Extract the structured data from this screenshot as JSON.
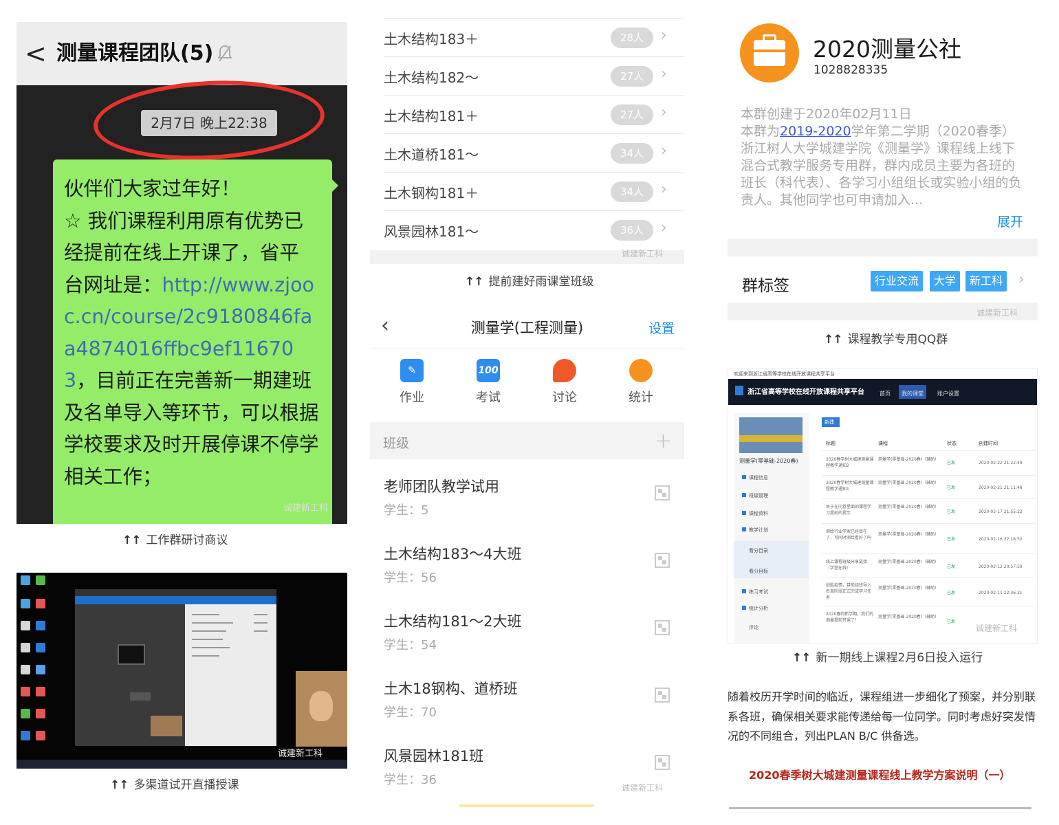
{
  "chat": {
    "back_icon": "back-arrow-icon",
    "title": "测量课程团队(5)",
    "mute_icon": "muted-bell-icon",
    "timestamp": "2月7日 晚上22:38",
    "message_lines": [
      "伙伴们大家过年好！",
      "☆ 我们课程利用原有优势已",
      "经提前在线上开课了，省平",
      "台网址是："
    ],
    "message_link": "http://www.zjooc.cn/course/2c9180846faa4874016ffbc9ef116703",
    "message_rest": "，目前正在完善新一期建班及名单导入等环节，可以根据学校要求及时开展停课不停学相关工作；",
    "watermark": "诚建新工科",
    "highlight_color": "#e8322b",
    "bubble_color": "#95ec69"
  },
  "captions": {
    "arrows": "↑↑",
    "chat": "工作群研讨商议",
    "desktop": "多渠道试开直播授课",
    "class_list": "提前建好雨课堂班级",
    "qq": "课程教学专用QQ群",
    "web": "新一期线上课程2月6日投入运行"
  },
  "desktop": {
    "watermark": "诚建新工科"
  },
  "class_counts": {
    "rows": [
      {
        "name": "土木结构183＋",
        "count": "28人"
      },
      {
        "name": "土木结构182～",
        "count": "27人"
      },
      {
        "name": "土木结构181＋",
        "count": "27人"
      },
      {
        "name": "土木道桥181～",
        "count": "34人"
      },
      {
        "name": "土木钢构181＋",
        "count": "34人"
      },
      {
        "name": "风景园林181～",
        "count": "36人"
      }
    ],
    "chevron": "›",
    "watermark": "诚建新工科"
  },
  "course_app": {
    "back": "‹",
    "title": "测量学(工程测量)",
    "settings": "设置",
    "nav": [
      {
        "label": "作业",
        "icon": "homework-icon",
        "color": "#2e8ef0"
      },
      {
        "label": "考试",
        "icon": "exam-icon",
        "color": "#2e8ef0",
        "glyph": "100"
      },
      {
        "label": "讨论",
        "icon": "discussion-icon",
        "color": "#f05a28"
      },
      {
        "label": "统计",
        "icon": "statistics-icon",
        "color": "#f6921e"
      }
    ],
    "section_label": "班级",
    "add": "+",
    "classes": [
      {
        "name": "老师团队教学试用",
        "students": "学生：5"
      },
      {
        "name": "土木结构183～4大班",
        "students": "学生：56"
      },
      {
        "name": "土木结构181～2大班",
        "students": "学生：54"
      },
      {
        "name": "土木18钢构、道桥班",
        "students": "学生：70"
      },
      {
        "name": "风景园林181班",
        "students": "学生：36"
      }
    ],
    "watermark": "诚建新工科"
  },
  "qq_group": {
    "name": "2020测量公社",
    "id": "1028828335",
    "desc_line1": "本群创建于2020年02月11日",
    "desc_prefix": "本群为",
    "desc_year": "2019-2020",
    "desc_rest": "学年第二学期（2020春季）浙江树人大学城建学院《测量学》课程线上线下混合式教学服务专用群，群内成员主要为各班的班长（科代表）、各学习小组组长或实验小组的负责人。其他同学也可申请加入...",
    "expand": "展开",
    "tag_label": "群标签",
    "tags": [
      "行业交流",
      "大学",
      "新工科"
    ],
    "chevron": "›",
    "watermark": "诚建新工科",
    "avatar_color": "#f6921e"
  },
  "web_platform": {
    "top_text": "欢迎来到浙江省高等学校在线开放课程共享平台",
    "title": "浙江省高等学校在线开放课程共享平台",
    "nav": [
      "首页",
      "我的课堂",
      "账户设置"
    ],
    "course_name": "测量学(零基础-2020春)",
    "menu": [
      "课程信息",
      "班级管理",
      "课程资料",
      "教学计划",
      "看分目录",
      "看分目标",
      "练习考试",
      "统计分析",
      "评论"
    ],
    "button": "新建",
    "headers": [
      "标题",
      "课程",
      "状态",
      "创建时间"
    ],
    "rows": [
      {
        "title": "2020春学树大城建测量课程教学通知2",
        "course": "测量学(零基础-2020春)（辅助）",
        "status": "已发",
        "time": "2020-02-22 21:22:49"
      },
      {
        "title": "2020春学树大城建测量课程教学通知1",
        "course": "测量学(零基础-2020春)（辅助）",
        "status": "已发",
        "time": "2020-02-21 21:11:48"
      },
      {
        "title": "关于在问卷里面的课程学习提前的提示",
        "course": "测量学(零基础-2020春)（辅助）",
        "status": "已发",
        "time": "2020-02-17 21:55:22"
      },
      {
        "title": "测绘行业学家已经审在了，可同时测绘看好了吗",
        "course": "测量学(零基础-2020春)（辅助）",
        "status": "已发",
        "time": "2020-02-16 22:18:50"
      },
      {
        "title": "线上课程班级分享链接（学堂在线）",
        "course": "测量学(零基础-2020春)（辅助）",
        "status": "已发",
        "time": "2020-02-12 20:57:59"
      },
      {
        "title": "战胜疫情，目前组班导入名单阶段正式完成学习任务",
        "course": "测量学(零基础-2020春)（辅助）",
        "status": "已发",
        "time": "2020-02-11 22:36:21"
      },
      {
        "title": "2020春的新学期，我们的测量提前开课了！",
        "course": "测量学(零基础-2020春)（辅助）",
        "status": "已发",
        "time": ""
      }
    ],
    "watermark": "诚建新工科"
  },
  "bottom": {
    "paragraph": "随着校历开学时间的临近，课程组进一步细化了预案，并分别联系各班，确保相关要求能传递给每一位同学。同时考虑好突发情况的不同组合，列出PLAN B/C 供备选。",
    "heading": "2020春季树大城建测量课程线上教学方案说明（一）"
  }
}
